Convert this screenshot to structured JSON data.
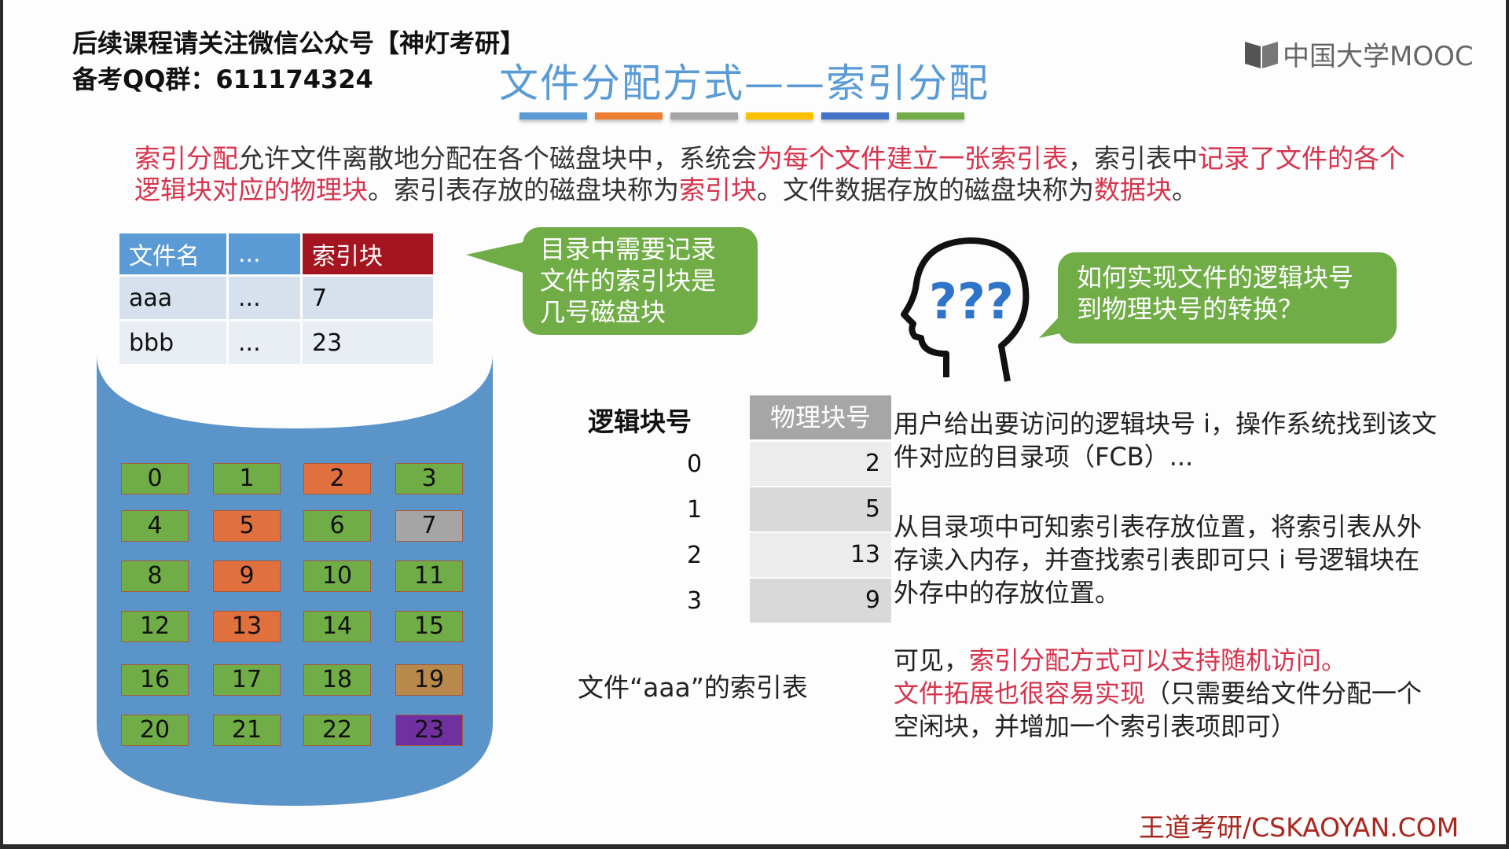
{
  "header": {
    "line1": "后续课程请关注微信公众号【神灯考研】",
    "line2": "备考QQ群：611174324"
  },
  "title": "文件分配方式——索引分配",
  "title_bar_colors": [
    "#5b9bd5",
    "#ed7d31",
    "#a5a5a5",
    "#ffc000",
    "#4472c4",
    "#70ad47"
  ],
  "logo": {
    "text": "中国大学MOOC",
    "icon": "book-icon"
  },
  "intro": {
    "segments": [
      {
        "text": "索引分配",
        "red": true
      },
      {
        "text": "允许文件离散地分配在各个磁盘块中，系统会",
        "red": false
      },
      {
        "text": "为每个文件建立一张索引表",
        "red": true
      },
      {
        "text": "，索引表中",
        "red": false
      },
      {
        "text": "记录了文件的各个逻辑块对应的物理块",
        "red": true
      },
      {
        "text": "。索引表存放的磁盘块称为",
        "red": false
      },
      {
        "text": "索引块",
        "red": true
      },
      {
        "text": "。文件数据存放的磁盘块称为",
        "red": false
      },
      {
        "text": "数据块",
        "red": true
      },
      {
        "text": "。",
        "red": false
      }
    ]
  },
  "directory_table": {
    "headers": [
      "文件名",
      "...",
      "索引块"
    ],
    "rows": [
      [
        "aaa",
        "...",
        "7"
      ],
      [
        "bbb",
        "...",
        "23"
      ]
    ]
  },
  "callout_directory": "目录中需要记录文件的索引块是几号磁盘块",
  "callout_question": "如何实现文件的逻辑块号到物理块号的转换？",
  "head_icon_text": "???",
  "disk_blocks": [
    {
      "n": "0",
      "c": "#70ad47"
    },
    {
      "n": "1",
      "c": "#70ad47"
    },
    {
      "n": "2",
      "c": "#e0703e"
    },
    {
      "n": "3",
      "c": "#70ad47"
    },
    {
      "n": "4",
      "c": "#70ad47"
    },
    {
      "n": "5",
      "c": "#e0703e"
    },
    {
      "n": "6",
      "c": "#70ad47"
    },
    {
      "n": "7",
      "c": "#a5a5a5"
    },
    {
      "n": "8",
      "c": "#70ad47"
    },
    {
      "n": "9",
      "c": "#e0703e"
    },
    {
      "n": "10",
      "c": "#70ad47"
    },
    {
      "n": "11",
      "c": "#70ad47"
    },
    {
      "n": "12",
      "c": "#70ad47"
    },
    {
      "n": "13",
      "c": "#e0703e"
    },
    {
      "n": "14",
      "c": "#70ad47"
    },
    {
      "n": "15",
      "c": "#70ad47"
    },
    {
      "n": "16",
      "c": "#70ad47"
    },
    {
      "n": "17",
      "c": "#70ad47"
    },
    {
      "n": "18",
      "c": "#70ad47"
    },
    {
      "n": "19",
      "c": "#b8894a"
    },
    {
      "n": "20",
      "c": "#70ad47"
    },
    {
      "n": "21",
      "c": "#70ad47"
    },
    {
      "n": "22",
      "c": "#70ad47"
    },
    {
      "n": "23",
      "c": "#7030a0"
    }
  ],
  "index_table": {
    "col_logical": "逻辑块号",
    "col_physical": "物理块号",
    "rows": [
      [
        "0",
        "2"
      ],
      [
        "1",
        "5"
      ],
      [
        "2",
        "13"
      ],
      [
        "3",
        "9"
      ]
    ],
    "caption": "文件“aaa”的索引表"
  },
  "explanation": {
    "p1": "用户给出要访问的逻辑块号 i，操作系统找到该文件对应的目录项（FCB）...",
    "p2": "从目录项中可知索引表存放位置，将索引表从外存读入内存，并查找索引表即可只 i 号逻辑块在外存中的存放位置。",
    "p3_prefix": "可见，",
    "p3_red1": "索引分配方式可以支持随机访问。",
    "p3_red2": "文件拓展也很容易实现",
    "p3_suffix": "（只需要给文件分配一个空闲块，并增加一个索引表项即可）"
  },
  "footer": "王道考研/CSKAOYAN.COM"
}
